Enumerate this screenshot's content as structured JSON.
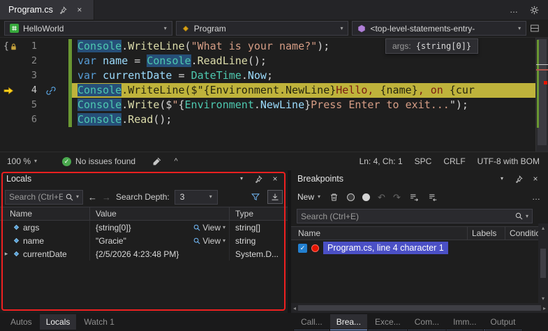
{
  "icons": {
    "close": "×",
    "chevron_down": "▾",
    "chevron_up": "^",
    "more": "…",
    "back": "←",
    "forward": "→",
    "undo": "↶",
    "redo": "↷",
    "check": "✓",
    "scroll_left": "◂",
    "scroll_right": "▸",
    "scroll_up": "▴",
    "scroll_down": "▾",
    "open_brace": "{"
  },
  "colors": {
    "current_statement_bg": "#bfb33b",
    "symbol_highlight_bg": "#264f78",
    "selection_indigo": "#4b50c6",
    "breakpoint_red": "#e51400",
    "change_bar_green": "#6a9732",
    "annotation_red": "#ee2020",
    "status_check_green": "#4aa94e"
  },
  "tab_bar": {
    "document_tab": "Program.cs"
  },
  "nav_bar": {
    "project": "HelloWorld",
    "type": "Program",
    "member": "<top-level-statements-entry-"
  },
  "editor": {
    "datatip_label": "args:",
    "datatip_value": "{string[0]}",
    "lines": [
      {
        "num": "1",
        "segments": [
          {
            "t": "Console",
            "c": "ty hl"
          },
          {
            "t": ".",
            "c": "pn"
          },
          {
            "t": "WriteLine",
            "c": "fn"
          },
          {
            "t": "(",
            "c": "pn"
          },
          {
            "t": "\"What is your name?\"",
            "c": "st"
          },
          {
            "t": ");",
            "c": "pn"
          }
        ]
      },
      {
        "num": "2",
        "segments": [
          {
            "t": "var",
            "c": "kw"
          },
          {
            "t": " ",
            "c": "pn"
          },
          {
            "t": "name",
            "c": "vr"
          },
          {
            "t": " = ",
            "c": "pn"
          },
          {
            "t": "Console",
            "c": "ty hl"
          },
          {
            "t": ".",
            "c": "pn"
          },
          {
            "t": "ReadLine",
            "c": "fn"
          },
          {
            "t": "();",
            "c": "pn"
          }
        ]
      },
      {
        "num": "3",
        "segments": [
          {
            "t": "var",
            "c": "kw"
          },
          {
            "t": " ",
            "c": "pn"
          },
          {
            "t": "currentDate",
            "c": "vr"
          },
          {
            "t": " = ",
            "c": "pn"
          },
          {
            "t": "DateTime",
            "c": "ty"
          },
          {
            "t": ".",
            "c": "pn"
          },
          {
            "t": "Now",
            "c": "vr"
          },
          {
            "t": ";",
            "c": "pn"
          }
        ]
      },
      {
        "num": "4",
        "segments": [
          {
            "t": "Console",
            "c": "ty hl"
          },
          {
            "t": ".WriteLine($\"",
            "c": "dk"
          },
          {
            "t": "{Environment.NewLine}",
            "c": "dk"
          },
          {
            "t": "Hello, ",
            "c": "dkst"
          },
          {
            "t": "{name}",
            "c": "dk"
          },
          {
            "t": ", on ",
            "c": "dkst"
          },
          {
            "t": "{cur",
            "c": "dk"
          }
        ]
      },
      {
        "num": "5",
        "segments": [
          {
            "t": "Console",
            "c": "ty hl"
          },
          {
            "t": ".",
            "c": "pn"
          },
          {
            "t": "Write",
            "c": "fn"
          },
          {
            "t": "($",
            "c": "pn"
          },
          {
            "t": "\"",
            "c": "st"
          },
          {
            "t": "{",
            "c": "pn"
          },
          {
            "t": "Environment",
            "c": "ty"
          },
          {
            "t": ".",
            "c": "pn"
          },
          {
            "t": "NewLine",
            "c": "vr"
          },
          {
            "t": "}",
            "c": "pn"
          },
          {
            "t": "Press Enter to exit...",
            "c": "st"
          },
          {
            "t": "\");",
            "c": "pn"
          }
        ]
      },
      {
        "num": "6",
        "segments": [
          {
            "t": "Console",
            "c": "ty hl"
          },
          {
            "t": ".",
            "c": "pn"
          },
          {
            "t": "Read",
            "c": "fn"
          },
          {
            "t": "();",
            "c": "pn"
          }
        ]
      }
    ]
  },
  "status_bar": {
    "zoom": "100 %",
    "issues": "No issues found",
    "line_col": "Ln: 4, Ch: 1",
    "whitespace": "SPC",
    "line_ending": "CRLF",
    "encoding": "UTF-8 with BOM"
  },
  "locals": {
    "title": "Locals",
    "search_placeholder": "Search (Ctrl+E)",
    "search_depth_label": "Search Depth:",
    "search_depth_value": "3",
    "columns": [
      "Name",
      "Value",
      "Type"
    ],
    "view_label": "View",
    "rows": [
      {
        "expander": "",
        "name": "args",
        "value": "{string[0]}",
        "type": "string[]"
      },
      {
        "expander": "",
        "name": "name",
        "value": "\"Gracie\"",
        "type": "string"
      },
      {
        "expander": "▸",
        "name": "currentDate",
        "value": "{2/5/2026 4:23:48 PM}",
        "type": "System.D..."
      }
    ],
    "tabs": [
      "Autos",
      "Locals",
      "Watch 1"
    ],
    "active_tab": "Locals"
  },
  "breakpoints": {
    "title": "Breakpoints",
    "new_label": "New",
    "search_placeholder": "Search (Ctrl+E)",
    "columns": [
      "Name",
      "Labels",
      "Conditions"
    ],
    "rows": [
      {
        "label": "Program.cs, line 4 character 1",
        "checked": true
      }
    ],
    "tabs": [
      "Call...",
      "Brea...",
      "Exce...",
      "Com...",
      "Imm...",
      "Output"
    ],
    "active_tab": "Brea..."
  }
}
